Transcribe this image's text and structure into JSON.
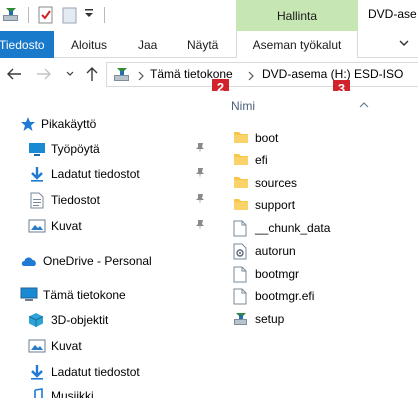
{
  "window": {
    "title": "DVD-ase"
  },
  "ribbon": {
    "contextual_group": "Hallinta",
    "tabs": [
      {
        "label": "Tiedosto"
      },
      {
        "label": "Aloitus"
      },
      {
        "label": "Jaa"
      },
      {
        "label": "Näytä"
      },
      {
        "label": "Aseman työkalut"
      }
    ]
  },
  "address": {
    "crumbs": [
      "Tämä tietokone",
      "DVD-asema (H:) ESD-ISO"
    ],
    "badges": [
      "2",
      "3"
    ]
  },
  "navpane": {
    "quick_access": "Pikakäyttö",
    "quick_items": [
      {
        "label": "Työpöytä"
      },
      {
        "label": "Ladatut tiedostot"
      },
      {
        "label": "Tiedostot"
      },
      {
        "label": "Kuvat"
      }
    ],
    "onedrive": "OneDrive - Personal",
    "this_pc": "Tämä tietokone",
    "pc_items": [
      {
        "label": "3D-objektit"
      },
      {
        "label": "Kuvat"
      },
      {
        "label": "Ladatut tiedostot"
      },
      {
        "label": "Musiikki"
      }
    ]
  },
  "content": {
    "column_name": "Nimi",
    "files": [
      {
        "name": "boot",
        "type": "folder"
      },
      {
        "name": "efi",
        "type": "folder"
      },
      {
        "name": "sources",
        "type": "folder"
      },
      {
        "name": "support",
        "type": "folder"
      },
      {
        "name": "__chunk_data",
        "type": "file"
      },
      {
        "name": "autorun",
        "type": "settings-file"
      },
      {
        "name": "bootmgr",
        "type": "file"
      },
      {
        "name": "bootmgr.efi",
        "type": "file"
      },
      {
        "name": "setup",
        "type": "setup-exe"
      }
    ]
  },
  "colors": {
    "file_tab": "#1979ca",
    "contextual_tab": "#c6e6b3",
    "folder": "#f7c74a",
    "badge": "#d0232b",
    "accent": "#0078d7"
  }
}
